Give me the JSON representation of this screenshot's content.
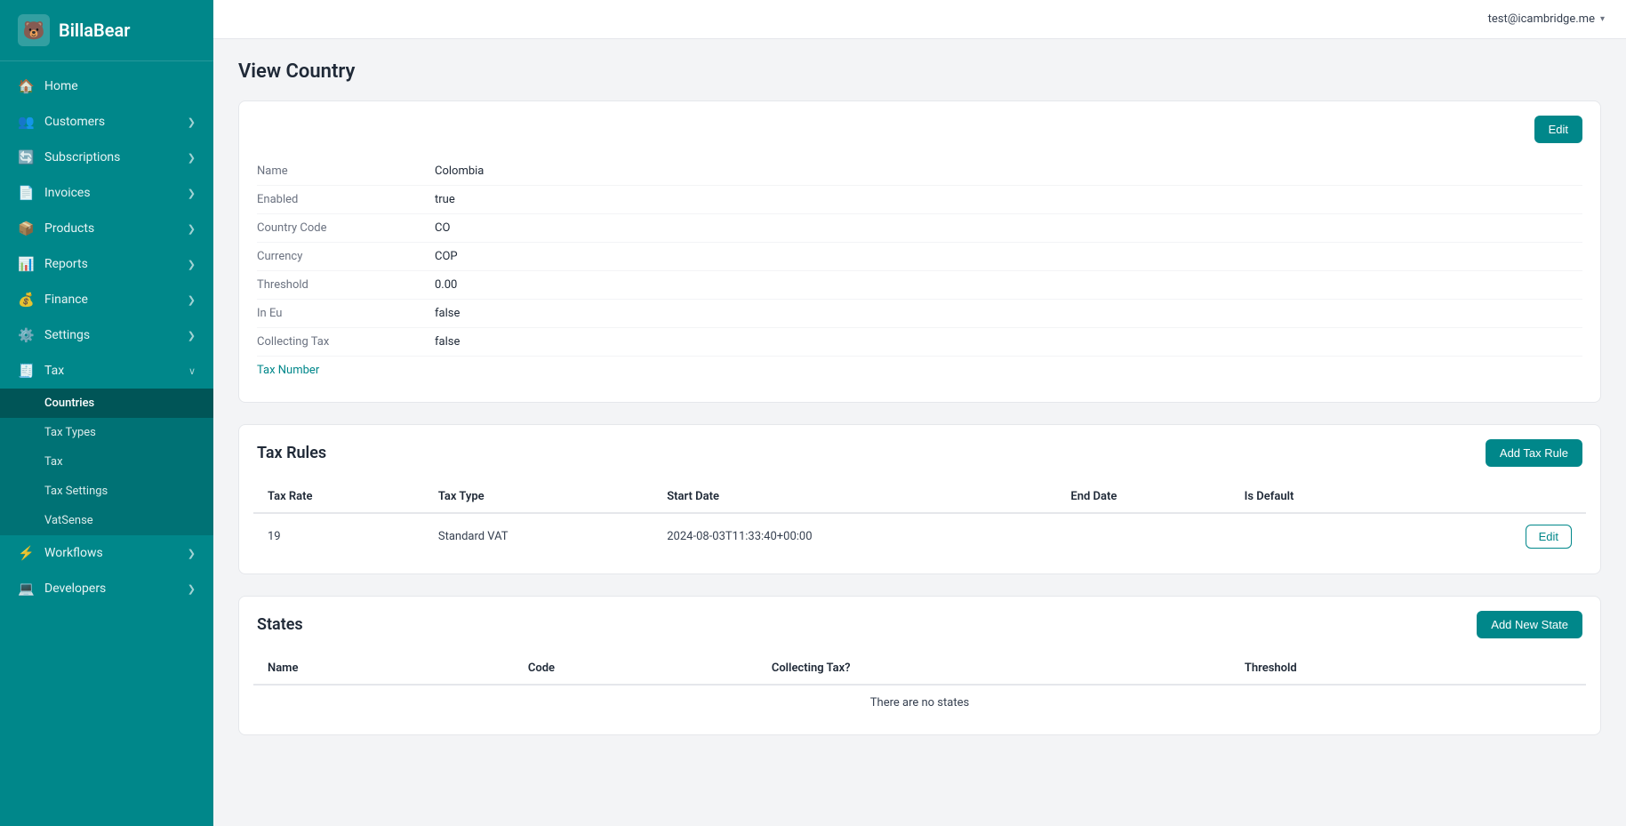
{
  "app": {
    "name": "BillaBear"
  },
  "topbar": {
    "user": "test@icambridge.me"
  },
  "sidebar": {
    "nav": [
      {
        "id": "home",
        "label": "Home",
        "icon": "🏠",
        "hasChildren": false
      },
      {
        "id": "customers",
        "label": "Customers",
        "icon": "👥",
        "hasChildren": true
      },
      {
        "id": "subscriptions",
        "label": "Subscriptions",
        "icon": "🔄",
        "hasChildren": true
      },
      {
        "id": "invoices",
        "label": "Invoices",
        "icon": "📄",
        "hasChildren": true
      },
      {
        "id": "products",
        "label": "Products",
        "icon": "📦",
        "hasChildren": true
      },
      {
        "id": "reports",
        "label": "Reports",
        "icon": "📊",
        "hasChildren": true
      },
      {
        "id": "finance",
        "label": "Finance",
        "icon": "💰",
        "hasChildren": true
      },
      {
        "id": "settings",
        "label": "Settings",
        "icon": "⚙️",
        "hasChildren": true
      },
      {
        "id": "tax",
        "label": "Tax",
        "icon": "🧾",
        "hasChildren": true
      }
    ],
    "taxSubmenu": [
      {
        "id": "countries",
        "label": "Countries",
        "active": true
      },
      {
        "id": "tax-types",
        "label": "Tax Types",
        "active": false
      },
      {
        "id": "tax",
        "label": "Tax",
        "active": false
      },
      {
        "id": "tax-settings",
        "label": "Tax Settings",
        "active": false
      },
      {
        "id": "vatsense",
        "label": "VatSense",
        "active": false
      }
    ],
    "bottomNav": [
      {
        "id": "workflows",
        "label": "Workflows",
        "icon": "⚡",
        "hasChildren": true
      },
      {
        "id": "developers",
        "label": "Developers",
        "icon": "💻",
        "hasChildren": true
      }
    ]
  },
  "page": {
    "title": "View Country",
    "edit_label": "Edit",
    "country": {
      "name_label": "Name",
      "name_value": "Colombia",
      "enabled_label": "Enabled",
      "enabled_value": "true",
      "country_code_label": "Country Code",
      "country_code_value": "CO",
      "currency_label": "Currency",
      "currency_value": "COP",
      "threshold_label": "Threshold",
      "threshold_value": "0.00",
      "in_eu_label": "In Eu",
      "in_eu_value": "false",
      "collecting_tax_label": "Collecting Tax",
      "collecting_tax_value": "false",
      "tax_number_label": "Tax Number",
      "tax_number_value": ""
    },
    "tax_rules": {
      "section_title": "Tax Rules",
      "add_button_label": "Add Tax Rule",
      "columns": [
        "Tax Rate",
        "Tax Type",
        "Start Date",
        "End Date",
        "Is Default"
      ],
      "rows": [
        {
          "tax_rate": "19",
          "tax_type": "Standard VAT",
          "start_date": "2024-08-03T11:33:40+00:00",
          "end_date": "",
          "is_default": ""
        }
      ],
      "edit_label": "Edit"
    },
    "states": {
      "section_title": "States",
      "add_button_label": "Add New State",
      "columns": [
        "Name",
        "Code",
        "Collecting Tax?",
        "Threshold"
      ],
      "empty_message": "There are no states"
    }
  }
}
